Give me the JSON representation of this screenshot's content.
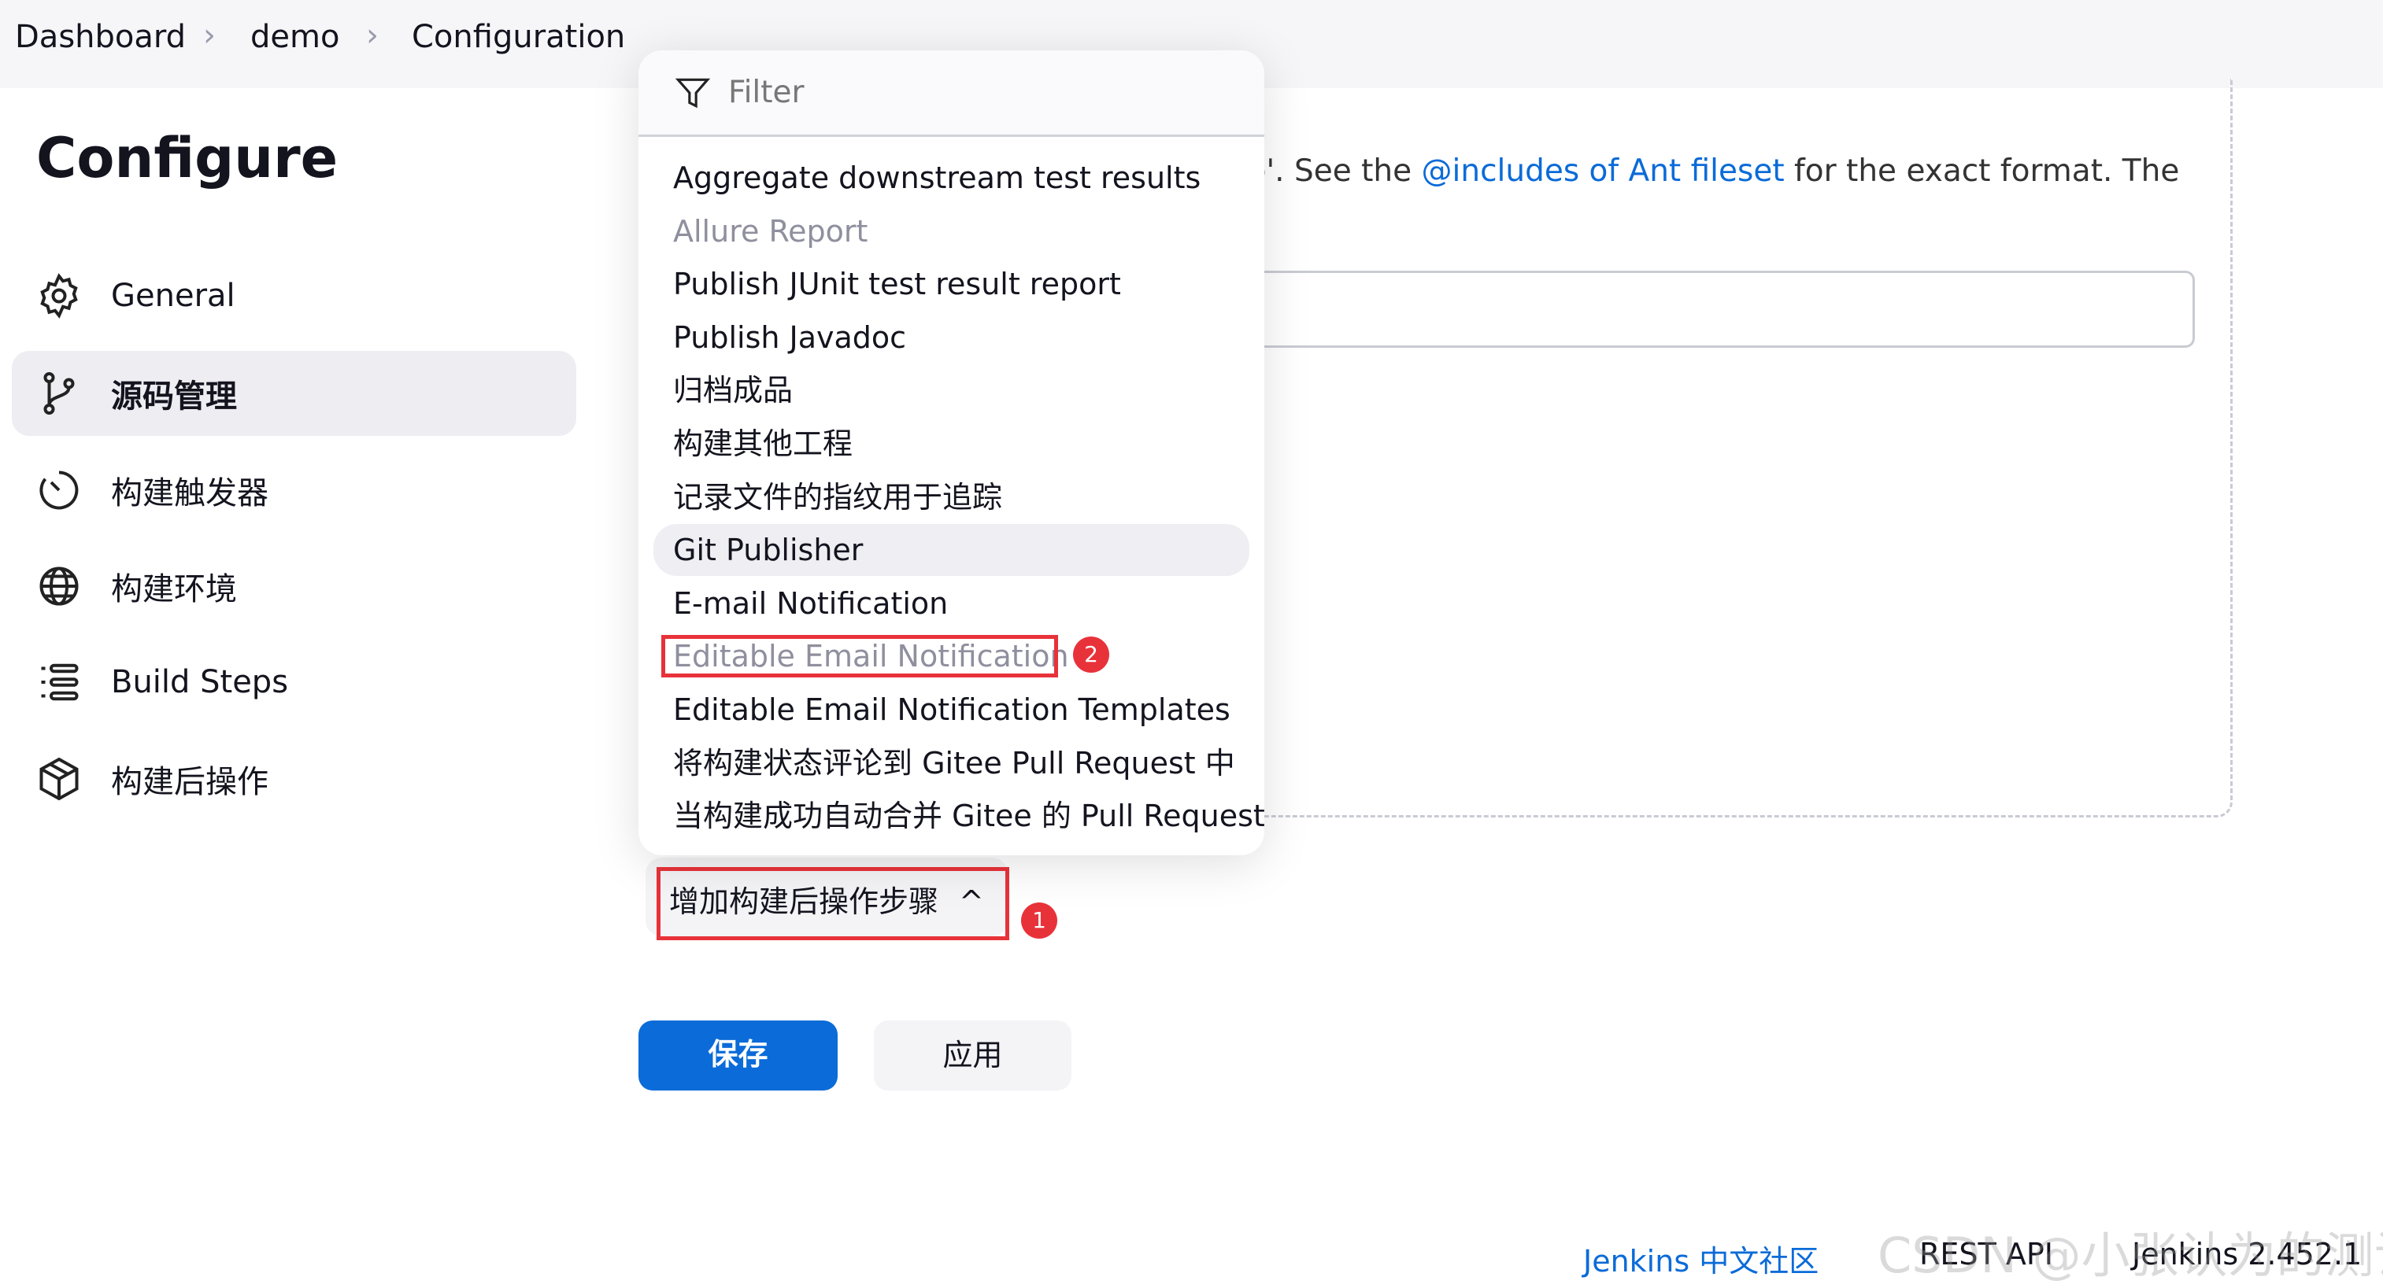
{
  "breadcrumb": [
    "Dashboard",
    "demo",
    "Configuration"
  ],
  "page_title": "Configure",
  "sidebar": {
    "items": [
      {
        "label": "General",
        "icon": "gear-icon"
      },
      {
        "label": "源码管理",
        "icon": "git-branch-icon",
        "active": true
      },
      {
        "label": "构建触发器",
        "icon": "clock-icon"
      },
      {
        "label": "构建环境",
        "icon": "globe-icon"
      },
      {
        "label": "Build Steps",
        "icon": "list-icon"
      },
      {
        "label": "构建后操作",
        "icon": "package-icon"
      }
    ]
  },
  "background": {
    "text_before": ".zip'. See the ",
    "link": "@includes of Ant fileset",
    "text_after": " for the exact format. The"
  },
  "menu": {
    "filter_placeholder": "Filter",
    "items": [
      "Aggregate downstream test results",
      "Allure Report",
      "Publish JUnit test result report",
      "Publish Javadoc",
      "归档成品",
      "构建其他工程",
      "记录文件的指纹用于追踪",
      "Git Publisher",
      "E-mail Notification",
      "Editable Email Notification",
      "Editable Email Notification Templates",
      "将构建状态评论到 Gitee Pull Request 中",
      "当构建成功自动合并 Gitee 的 Pull Request"
    ],
    "hovered": "Git Publisher",
    "dimmed": [
      "Allure Report",
      "Editable Email Notification"
    ]
  },
  "add_step_button": "增加构建后操作步骤",
  "annotations": {
    "badge1": "1",
    "badge2": "2",
    "color": "#e8323a"
  },
  "buttons": {
    "save": "保存",
    "apply": "应用"
  },
  "footer": {
    "community": "Jenkins 中文社区",
    "rest_api": "REST API",
    "version": "Jenkins 2.452.1"
  },
  "watermark": "CSDN @小张认为的测试",
  "colors": {
    "accent": "#0b6bd8"
  }
}
